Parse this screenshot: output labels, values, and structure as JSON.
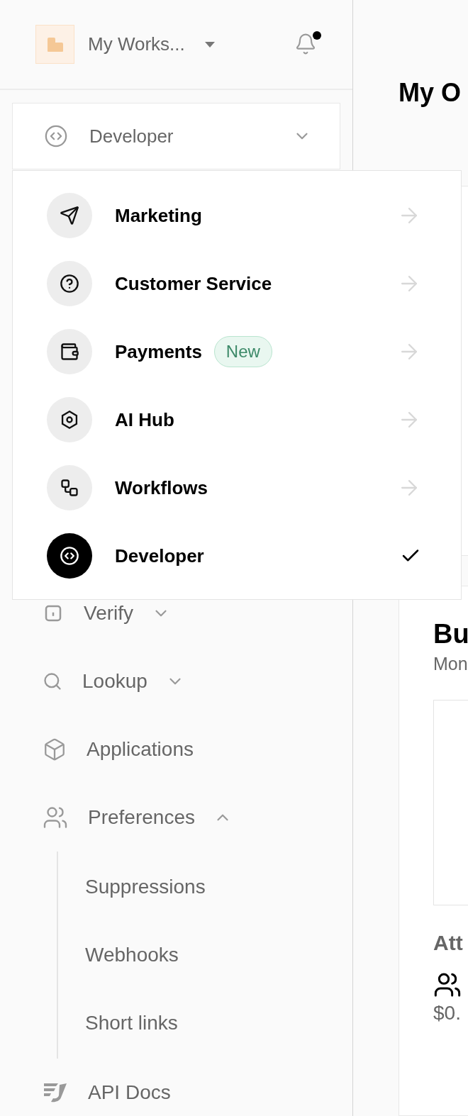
{
  "workspace": {
    "name": "My Works...",
    "notification_dot": true
  },
  "product_select": {
    "label": "Developer",
    "expanded": true
  },
  "product_menu": {
    "items": [
      {
        "label": "Marketing",
        "selected": false
      },
      {
        "label": "Customer Service",
        "selected": false
      },
      {
        "label": "Payments",
        "badge": "New",
        "selected": false
      },
      {
        "label": "AI Hub",
        "selected": false
      },
      {
        "label": "Workflows",
        "selected": false
      },
      {
        "label": "Developer",
        "selected": true
      }
    ]
  },
  "nav": {
    "items": [
      {
        "label": "Verify",
        "expanded": false
      },
      {
        "label": "Lookup",
        "expanded": false
      },
      {
        "label": "Applications"
      },
      {
        "label": "Preferences",
        "expanded": true,
        "children": [
          {
            "label": "Suppressions"
          },
          {
            "label": "Webhooks"
          },
          {
            "label": "Short links"
          }
        ]
      },
      {
        "label": "API Docs"
      }
    ]
  },
  "main": {
    "title": "My O",
    "section": {
      "title": "Bu",
      "subtitle": "Mon",
      "subsection_title": "Att",
      "value": "$0."
    }
  }
}
